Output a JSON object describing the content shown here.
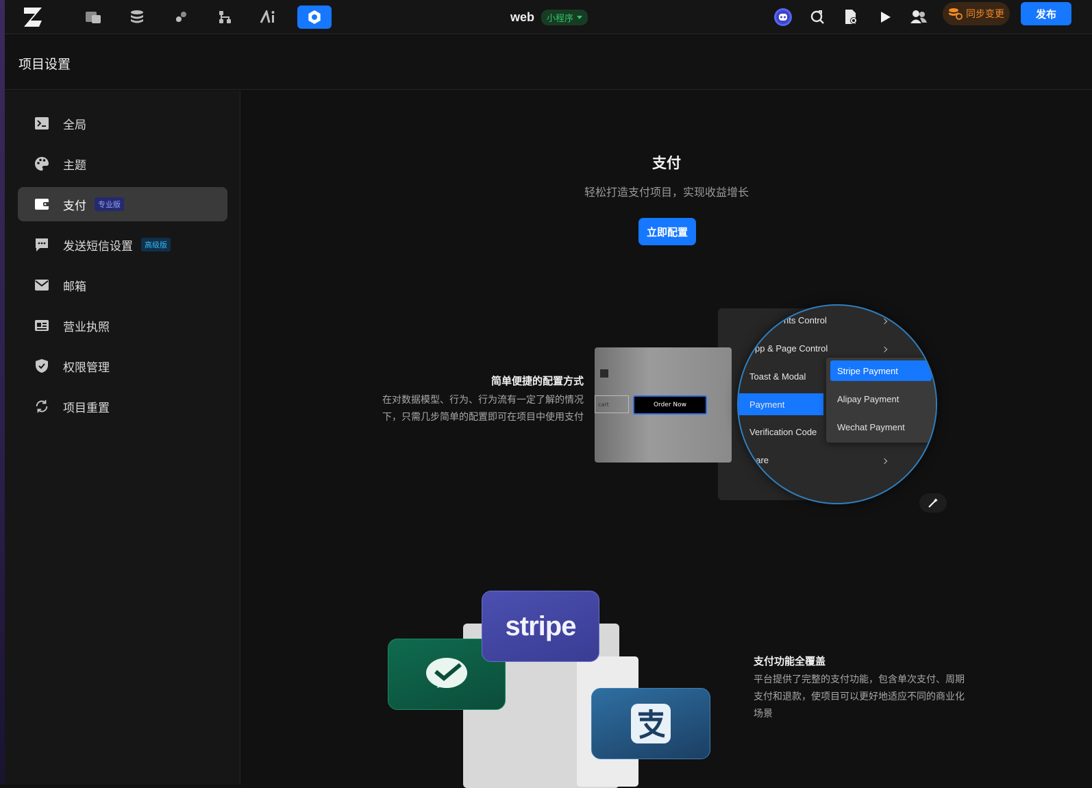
{
  "topbar": {
    "project_name": "web",
    "platform_badge": "小程序",
    "sync_label": "同步变更",
    "publish_label": "发布",
    "icons": [
      "pages-icon",
      "database-icon",
      "plugin-icon",
      "workflow-icon",
      "ai-icon",
      "settings-icon"
    ],
    "right_icons": [
      "discord-icon",
      "search-refresh-icon",
      "file-settings-icon",
      "play-icon",
      "users-icon"
    ]
  },
  "page": {
    "title": "项目设置"
  },
  "sidebar": {
    "items": [
      {
        "label": "全局",
        "icon": "terminal-icon",
        "badge": ""
      },
      {
        "label": "主题",
        "icon": "palette-icon",
        "badge": ""
      },
      {
        "label": "支付",
        "icon": "wallet-icon",
        "badge": "专业版"
      },
      {
        "label": "发送短信设置",
        "icon": "sms-icon",
        "badge": "高级版"
      },
      {
        "label": "邮箱",
        "icon": "mail-icon",
        "badge": ""
      },
      {
        "label": "营业执照",
        "icon": "license-icon",
        "badge": ""
      },
      {
        "label": "权限管理",
        "icon": "shield-icon",
        "badge": ""
      },
      {
        "label": "项目重置",
        "icon": "reset-icon",
        "badge": ""
      }
    ],
    "active_index": 2
  },
  "main": {
    "title": "支付",
    "subtitle": "轻松打造支付项目，实现收益增长",
    "configure_button": "立即配置",
    "feature1": {
      "title": "简单便捷的配置方式",
      "desc": "在对数据模型、行为、行为流有一定了解的情况下，只需几步简单的配置即可在项目中使用支付"
    },
    "feature2": {
      "title": "支付功能全覆盖",
      "desc": "平台提供了完整的支付功能，包含单次支付、周期支付和退款，使项目可以更好地适应不同的商业化场景"
    },
    "mock": {
      "order_button": "Order Now",
      "cart_label": "cart",
      "menu": [
        "nts Control",
        "pp & Page Control",
        "Toast & Modal",
        "Payment",
        "Verification Code",
        "hare"
      ],
      "submenu": [
        "Stripe Payment",
        "Alipay Payment",
        "Wechat Payment"
      ],
      "stripe_word": "stripe"
    }
  },
  "colors": {
    "accent": "#1677ff",
    "pro_badge": "#8fa2ff",
    "adv_badge": "#35b7f0",
    "sync": "#f08a28",
    "mini_program": "#35c06a"
  }
}
